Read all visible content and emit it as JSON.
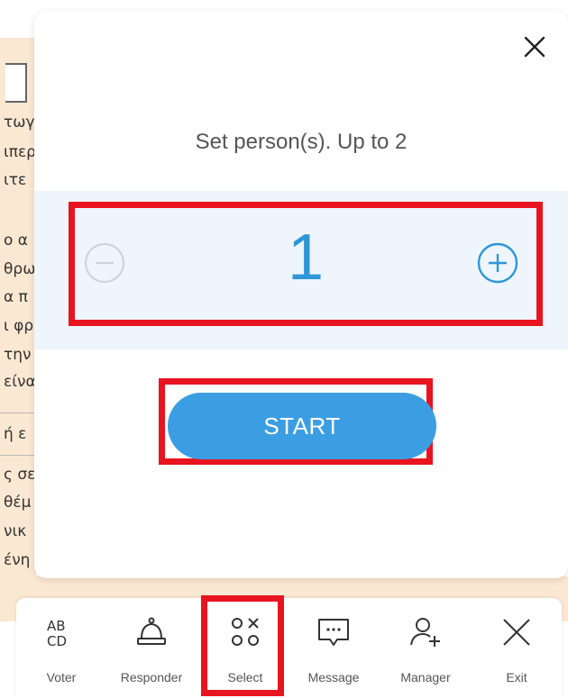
{
  "background_doc": {
    "lines": [
      "τωγ",
      "ιπερ",
      "ιτε",
      "ο α",
      "θρω",
      "α π",
      "ι φρ",
      "την",
      "είνα",
      "ή ε",
      "ς σε",
      "θέμ",
      "νικ",
      "ένη"
    ]
  },
  "dialog": {
    "prompt": "Set person(s). Up to 2",
    "count": "1",
    "start_label": "START",
    "accent_color": "#2f97d8",
    "button_color": "#3c9ee2",
    "highlight_color": "#e8141f"
  },
  "toolbar": {
    "items": [
      {
        "label": "Voter",
        "icon": "abcd-icon"
      },
      {
        "label": "Responder",
        "icon": "bell-icon"
      },
      {
        "label": "Select",
        "icon": "select-shapes-icon"
      },
      {
        "label": "Message",
        "icon": "message-icon"
      },
      {
        "label": "Manager",
        "icon": "add-person-icon"
      },
      {
        "label": "Exit",
        "icon": "close-icon"
      }
    ]
  }
}
